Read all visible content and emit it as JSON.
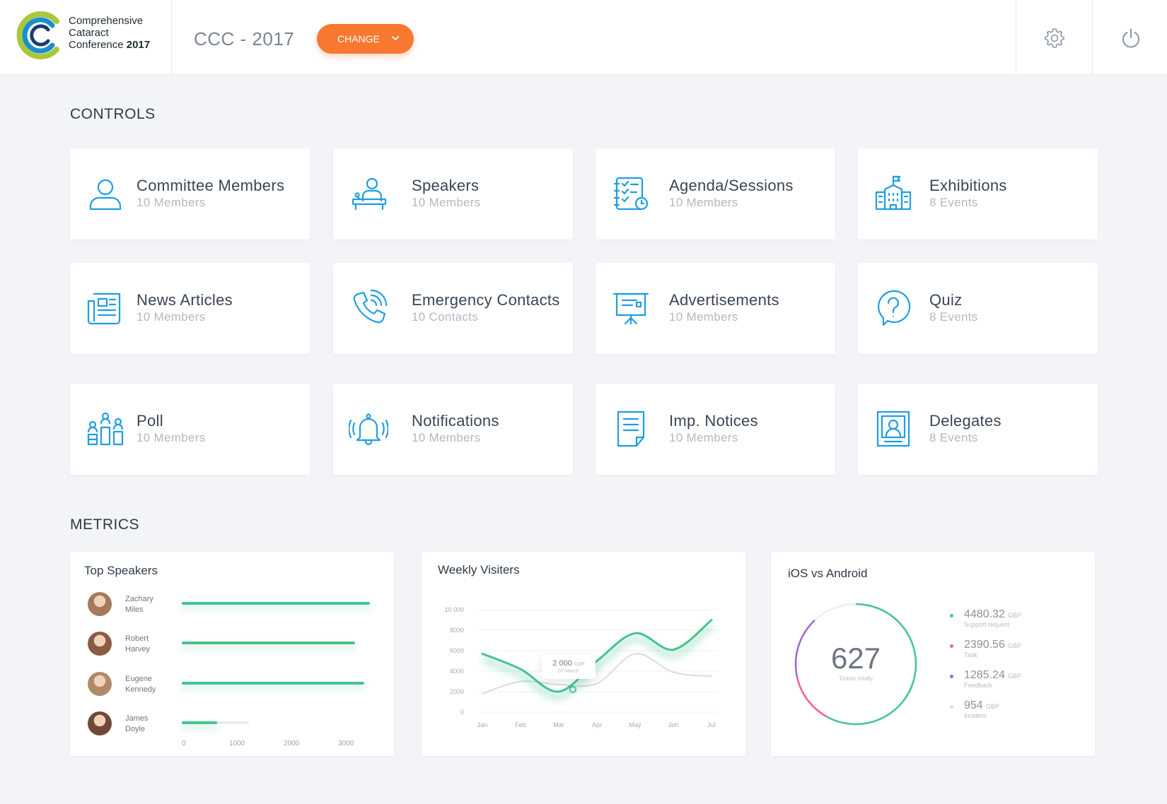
{
  "brand": {
    "line1": "Comprehensive",
    "line2": "Cataract",
    "line3_plain": "Conference",
    "line3_bold": "2017"
  },
  "header": {
    "event_title": "CCC  - 2017",
    "change_label": "CHANGE"
  },
  "sections": {
    "controls": "CONTROLS",
    "metrics": "METRICS"
  },
  "controls": [
    {
      "title": "Committee Members",
      "subtitle": "10 Members",
      "icon": "user-icon"
    },
    {
      "title": "Speakers",
      "subtitle": "10 Members",
      "icon": "speaker-podium-icon"
    },
    {
      "title": "Agenda/Sessions",
      "subtitle": "10 Members",
      "icon": "agenda-checklist-icon"
    },
    {
      "title": "Exhibitions",
      "subtitle": "8 Events",
      "icon": "building-flag-icon"
    },
    {
      "title": "News Articles",
      "subtitle": "10 Members",
      "icon": "newspaper-icon"
    },
    {
      "title": "Emergency Contacts",
      "subtitle": "10 Contacts",
      "icon": "phone-icon"
    },
    {
      "title": "Advertisements",
      "subtitle": "10 Members",
      "icon": "presentation-board-icon"
    },
    {
      "title": "Quiz",
      "subtitle": "8 Events",
      "icon": "question-bubble-icon"
    },
    {
      "title": "Poll",
      "subtitle": "10 Members",
      "icon": "poll-people-icon"
    },
    {
      "title": "Notifications",
      "subtitle": "10 Members",
      "icon": "bell-icon"
    },
    {
      "title": "Imp. Notices",
      "subtitle": "10 Members",
      "icon": "notice-document-icon"
    },
    {
      "title": "Delegates",
      "subtitle": "8 Events",
      "icon": "delegate-id-icon"
    }
  ],
  "top_speakers": {
    "title": "Top Speakers",
    "axis_ticks": [
      "0",
      "1000",
      "2000",
      "3000"
    ],
    "speakers": [
      {
        "first": "Zachary",
        "last": "Miles",
        "value": 3450,
        "avatar_color": "#a47a5c"
      },
      {
        "first": "Robert",
        "last": "Harvey",
        "value": 3180,
        "avatar_color": "#8a5b44"
      },
      {
        "first": "Eugene",
        "last": "Kennedy",
        "value": 3340,
        "avatar_color": "#b08a6a"
      },
      {
        "first": "James",
        "last": "Doyle",
        "value": 650,
        "avatar_color": "#6e4a36"
      }
    ]
  },
  "weekly_visitors": {
    "title": "Weekly Visiters",
    "tooltip_value": "2 000",
    "tooltip_unit": "GBP",
    "tooltip_date": "07 March"
  },
  "ios_android": {
    "title": "iOS vs Android",
    "total": "627",
    "total_caption": "Tickets totally",
    "legend": [
      {
        "value": "4480.32",
        "unit": "GBP",
        "caption": "Support request",
        "color": "#45c48f"
      },
      {
        "value": "2390.56",
        "unit": "GBP",
        "caption": "Task",
        "color": "#f06292"
      },
      {
        "value": "1285.24",
        "unit": "GBP",
        "caption": "Feedback",
        "color": "#9c6ad8"
      },
      {
        "value": "954",
        "unit": "GBP",
        "caption": "Incident",
        "color": "#d8dce1"
      }
    ]
  },
  "chart_data": [
    {
      "type": "bar",
      "title": "Top Speakers",
      "categories": [
        "Zachary Miles",
        "Robert Harvey",
        "Eugene Kennedy",
        "James Doyle"
      ],
      "values": [
        3450,
        3180,
        3340,
        650
      ],
      "xlim": [
        0,
        3500
      ],
      "orientation": "horizontal"
    },
    {
      "type": "line",
      "title": "Weekly Visiters",
      "x": [
        "Jan",
        "Feb",
        "Mar",
        "Apr",
        "May",
        "Jun",
        "Jul"
      ],
      "ylim": [
        0,
        10000
      ],
      "yticks": [
        "10 000",
        "8000",
        "6000",
        "4000",
        "2000",
        "0"
      ],
      "series": [
        {
          "values": [
            5700,
            4200,
            2000,
            5000,
            7700,
            6100,
            9000
          ],
          "color": "#45c48f"
        },
        {
          "values": [
            1800,
            3000,
            2700,
            2800,
            5700,
            3900,
            3500
          ],
          "color": "#d9dde2"
        }
      ]
    },
    {
      "type": "pie",
      "title": "iOS vs Android",
      "labels": [
        "Support request",
        "Task",
        "Feedback",
        "Incident"
      ],
      "values": [
        4480.32,
        2390.56,
        1285.24,
        954
      ]
    }
  ]
}
